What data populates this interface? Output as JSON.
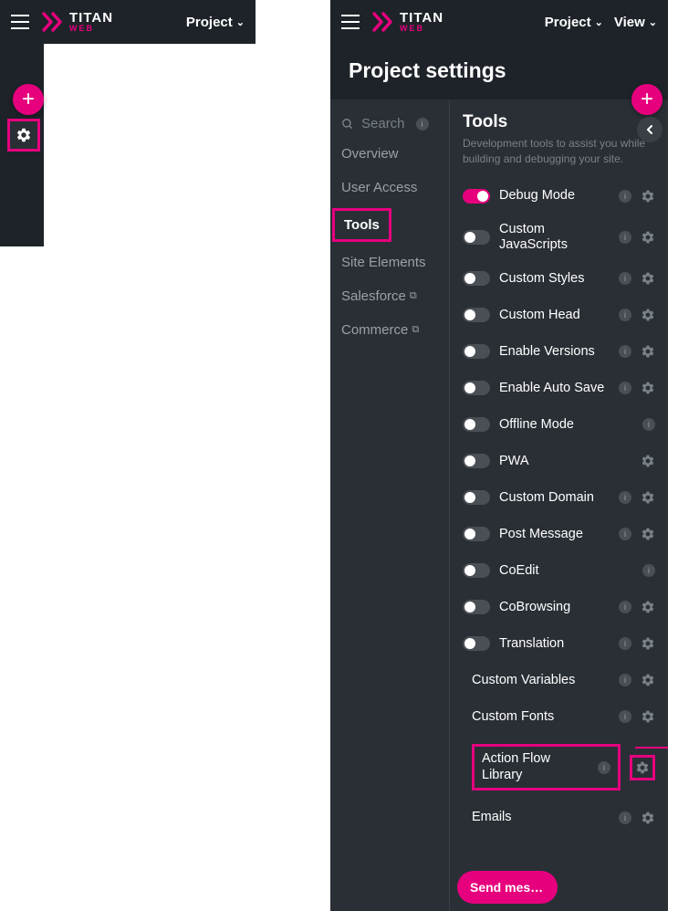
{
  "brand": {
    "main": "TITAN",
    "sub": "WEB"
  },
  "topbar": {
    "project": "Project",
    "view": "View"
  },
  "header": {
    "title": "Project settings"
  },
  "nav": {
    "search": "Search",
    "items": [
      {
        "label": "Overview"
      },
      {
        "label": "User Access"
      },
      {
        "label": "Tools",
        "active": true
      },
      {
        "label": "Site Elements"
      },
      {
        "label": "Salesforce",
        "external": true
      },
      {
        "label": "Commerce",
        "external": true
      }
    ]
  },
  "tools": {
    "title": "Tools",
    "desc": "Development tools to assist you while building and debugging your site.",
    "rows": [
      {
        "label": "Debug Mode",
        "toggle": true,
        "on": true,
        "info": true,
        "gear": true
      },
      {
        "label": "Custom JavaScripts",
        "toggle": true,
        "on": false,
        "info": true,
        "gear": true
      },
      {
        "label": "Custom Styles",
        "toggle": true,
        "on": false,
        "info": true,
        "gear": true
      },
      {
        "label": "Custom Head",
        "toggle": true,
        "on": false,
        "info": true,
        "gear": true
      },
      {
        "label": "Enable Versions",
        "toggle": true,
        "on": false,
        "info": true,
        "gear": true
      },
      {
        "label": "Enable Auto Save",
        "toggle": true,
        "on": false,
        "info": true,
        "gear": true
      },
      {
        "label": "Offline Mode",
        "toggle": true,
        "on": false,
        "info": true,
        "gear": false
      },
      {
        "label": "PWA",
        "toggle": true,
        "on": false,
        "info": false,
        "gear": true
      },
      {
        "label": "Custom Domain",
        "toggle": true,
        "on": false,
        "info": true,
        "gear": true
      },
      {
        "label": "Post Message",
        "toggle": true,
        "on": false,
        "info": true,
        "gear": true
      },
      {
        "label": "CoEdit",
        "toggle": true,
        "on": false,
        "info": true,
        "gear": false
      },
      {
        "label": "CoBrowsing",
        "toggle": true,
        "on": false,
        "info": true,
        "gear": true
      },
      {
        "label": "Translation",
        "toggle": true,
        "on": false,
        "info": true,
        "gear": true
      },
      {
        "label": "Custom Variables",
        "toggle": false,
        "info": true,
        "gear": true
      },
      {
        "label": "Custom Fonts",
        "toggle": false,
        "info": true,
        "gear": true
      },
      {
        "label": "Action Flow Library",
        "toggle": false,
        "info": true,
        "gear": true,
        "highlight": true
      },
      {
        "label": "Emails",
        "toggle": false,
        "info": true,
        "gear": true
      }
    ]
  },
  "sendMsg": "Send mes…"
}
